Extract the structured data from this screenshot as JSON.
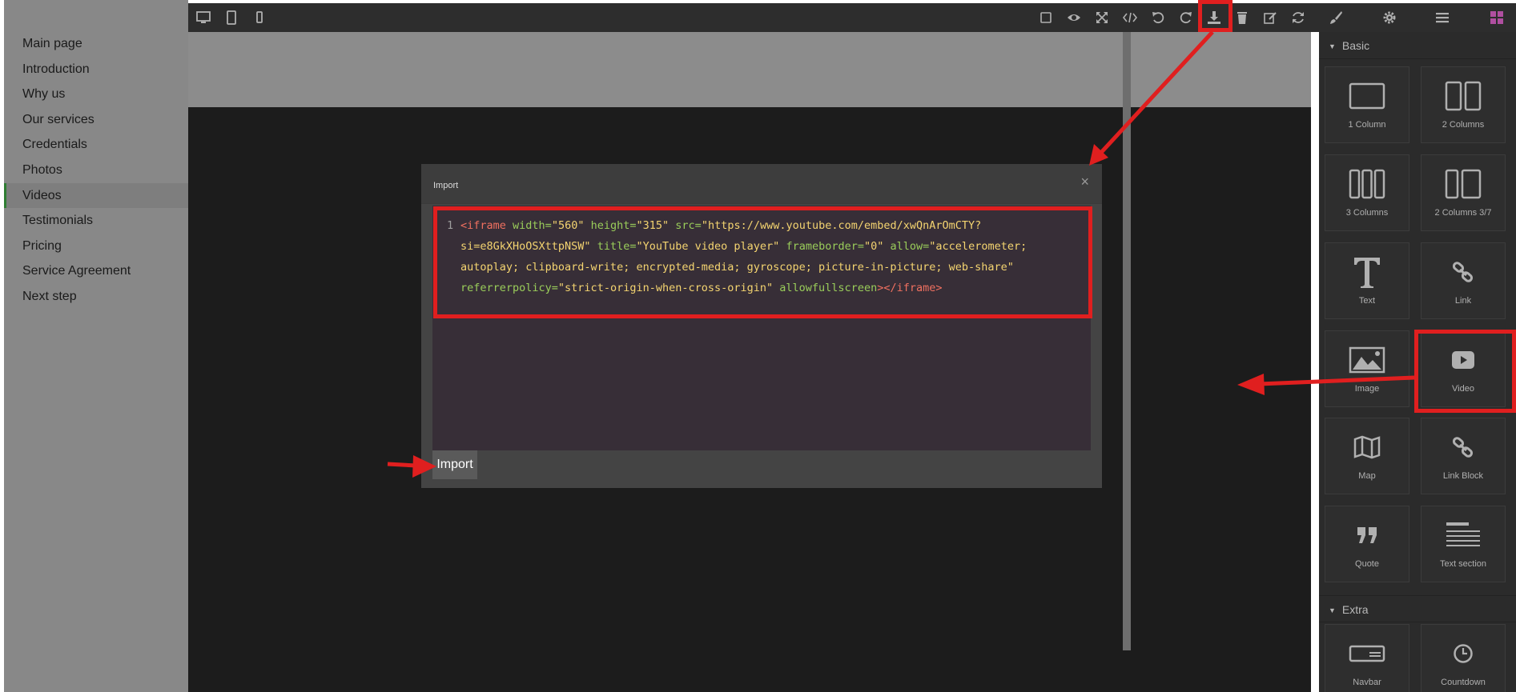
{
  "sidebar": {
    "items": [
      "Main page",
      "Introduction",
      "Why us",
      "Our services",
      "Credentials",
      "Photos",
      "Videos",
      "Testimonials",
      "Pricing",
      "Service Agreement",
      "Next step"
    ],
    "active": "Videos"
  },
  "toolbar": {
    "left": [
      "desktop-icon",
      "tablet-icon",
      "mobile-icon"
    ],
    "right": [
      "square-icon",
      "eye-icon",
      "fullscreen-icon",
      "code-icon",
      "undo-icon",
      "redo-icon",
      "download-icon",
      "trash-icon",
      "edit-icon",
      "refresh-icon",
      "brush-icon",
      "gear-icon",
      "menu-icon",
      "grid-icon"
    ]
  },
  "modal": {
    "title": "Import",
    "close": "×",
    "code": {
      "line_number": "1",
      "tag_open": "<iframe",
      "width_attr": "width=",
      "width_val": "\"560\"",
      "height_attr": "height=",
      "height_val": "\"315\"",
      "src_attr": "src=",
      "src_val": "\"https://www.youtube.com/embed/xwQnArOmCTY?si=e8GkXHoOSXttpNSW\"",
      "title_attr": "title=",
      "title_val": "\"YouTube video player\"",
      "frameborder_attr": "frameborder=",
      "frameborder_val": "\"0\"",
      "allow_attr": "allow=",
      "allow_val": "\"accelerometer; autoplay; clipboard-write; encrypted-media; gyroscope; picture-in-picture; web-share\"",
      "referrer_attr": "referrerpolicy=",
      "referrer_val": "\"strict-origin-when-cross-origin\"",
      "allowfull_attr": "allowfullscreen",
      "tag_close": "></iframe>"
    },
    "import_button": "Import"
  },
  "blocks": {
    "basic_title": "Basic",
    "extra_title": "Extra",
    "basic": [
      {
        "label": "1 Column",
        "icon": "one-column-icon"
      },
      {
        "label": "2 Columns",
        "icon": "two-columns-icon"
      },
      {
        "label": "3 Columns",
        "icon": "three-columns-icon"
      },
      {
        "label": "2 Columns 3/7",
        "icon": "two-columns-37-icon"
      },
      {
        "label": "Text",
        "icon": "text-icon"
      },
      {
        "label": "Link",
        "icon": "link-icon"
      },
      {
        "label": "Image",
        "icon": "image-icon"
      },
      {
        "label": "Video",
        "icon": "video-icon"
      },
      {
        "label": "Map",
        "icon": "map-icon"
      },
      {
        "label": "Link Block",
        "icon": "link-block-icon"
      },
      {
        "label": "Quote",
        "icon": "quote-icon"
      },
      {
        "label": "Text section",
        "icon": "text-section-icon"
      }
    ],
    "extra": [
      {
        "label": "Navbar",
        "icon": "navbar-icon"
      },
      {
        "label": "Countdown",
        "icon": "countdown-icon"
      }
    ]
  },
  "colors": {
    "annotation_red": "#e01f1f",
    "sidebar_bg": "#888888",
    "canvas_bg": "#1c1c1c",
    "panel_bg": "#2b2b2b",
    "accent_grid": "#b04fa0"
  }
}
